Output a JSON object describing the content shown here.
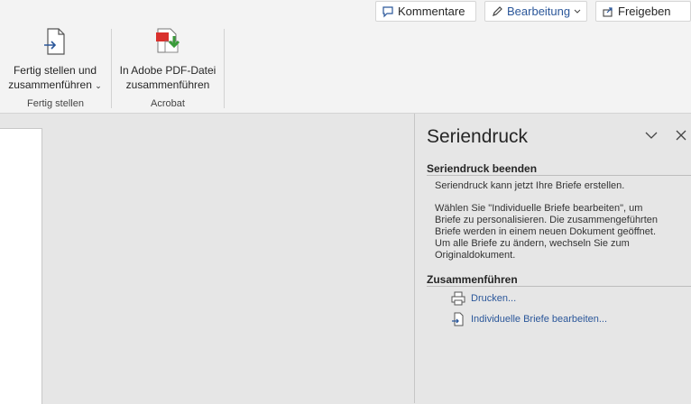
{
  "ribbon": {
    "top_buttons": {
      "comments": {
        "label": "Kommentare",
        "icon": "comment-icon"
      },
      "editing": {
        "label": "Bearbeitung",
        "icon": "pencil-icon"
      },
      "share": {
        "label": "Freigeben",
        "icon": "share-icon"
      }
    },
    "groups": [
      {
        "label": "Fertig stellen",
        "button": {
          "line1": "Fertig stellen und",
          "line2": "zusammenführen",
          "icon": "finish-merge-icon"
        }
      },
      {
        "label": "Acrobat",
        "button": {
          "line1": "In Adobe PDF-Datei",
          "line2": "zusammenführen",
          "icon": "pdf-merge-icon"
        }
      }
    ]
  },
  "panel": {
    "title": "Seriendruck",
    "section1": {
      "heading": "Seriendruck beenden",
      "para1": "Seriendruck kann jetzt Ihre Briefe erstellen.",
      "para2": "Wählen Sie \"Individuelle Briefe bearbeiten\", um Briefe zu personalisieren. Die zusammengeführten Briefe werden in einem neuen Dokument geöffnet. Um alle Briefe zu ändern, wechseln Sie zum Originaldokument."
    },
    "section2": {
      "heading": "Zusammenführen",
      "links": [
        {
          "label": "Drucken...",
          "icon": "printer-icon"
        },
        {
          "label": "Individuelle Briefe bearbeiten...",
          "icon": "edit-document-icon"
        }
      ]
    }
  },
  "colors": {
    "link": "#2b579a",
    "accent_green": "#3a9b3a",
    "pdf_red": "#d9302c"
  }
}
